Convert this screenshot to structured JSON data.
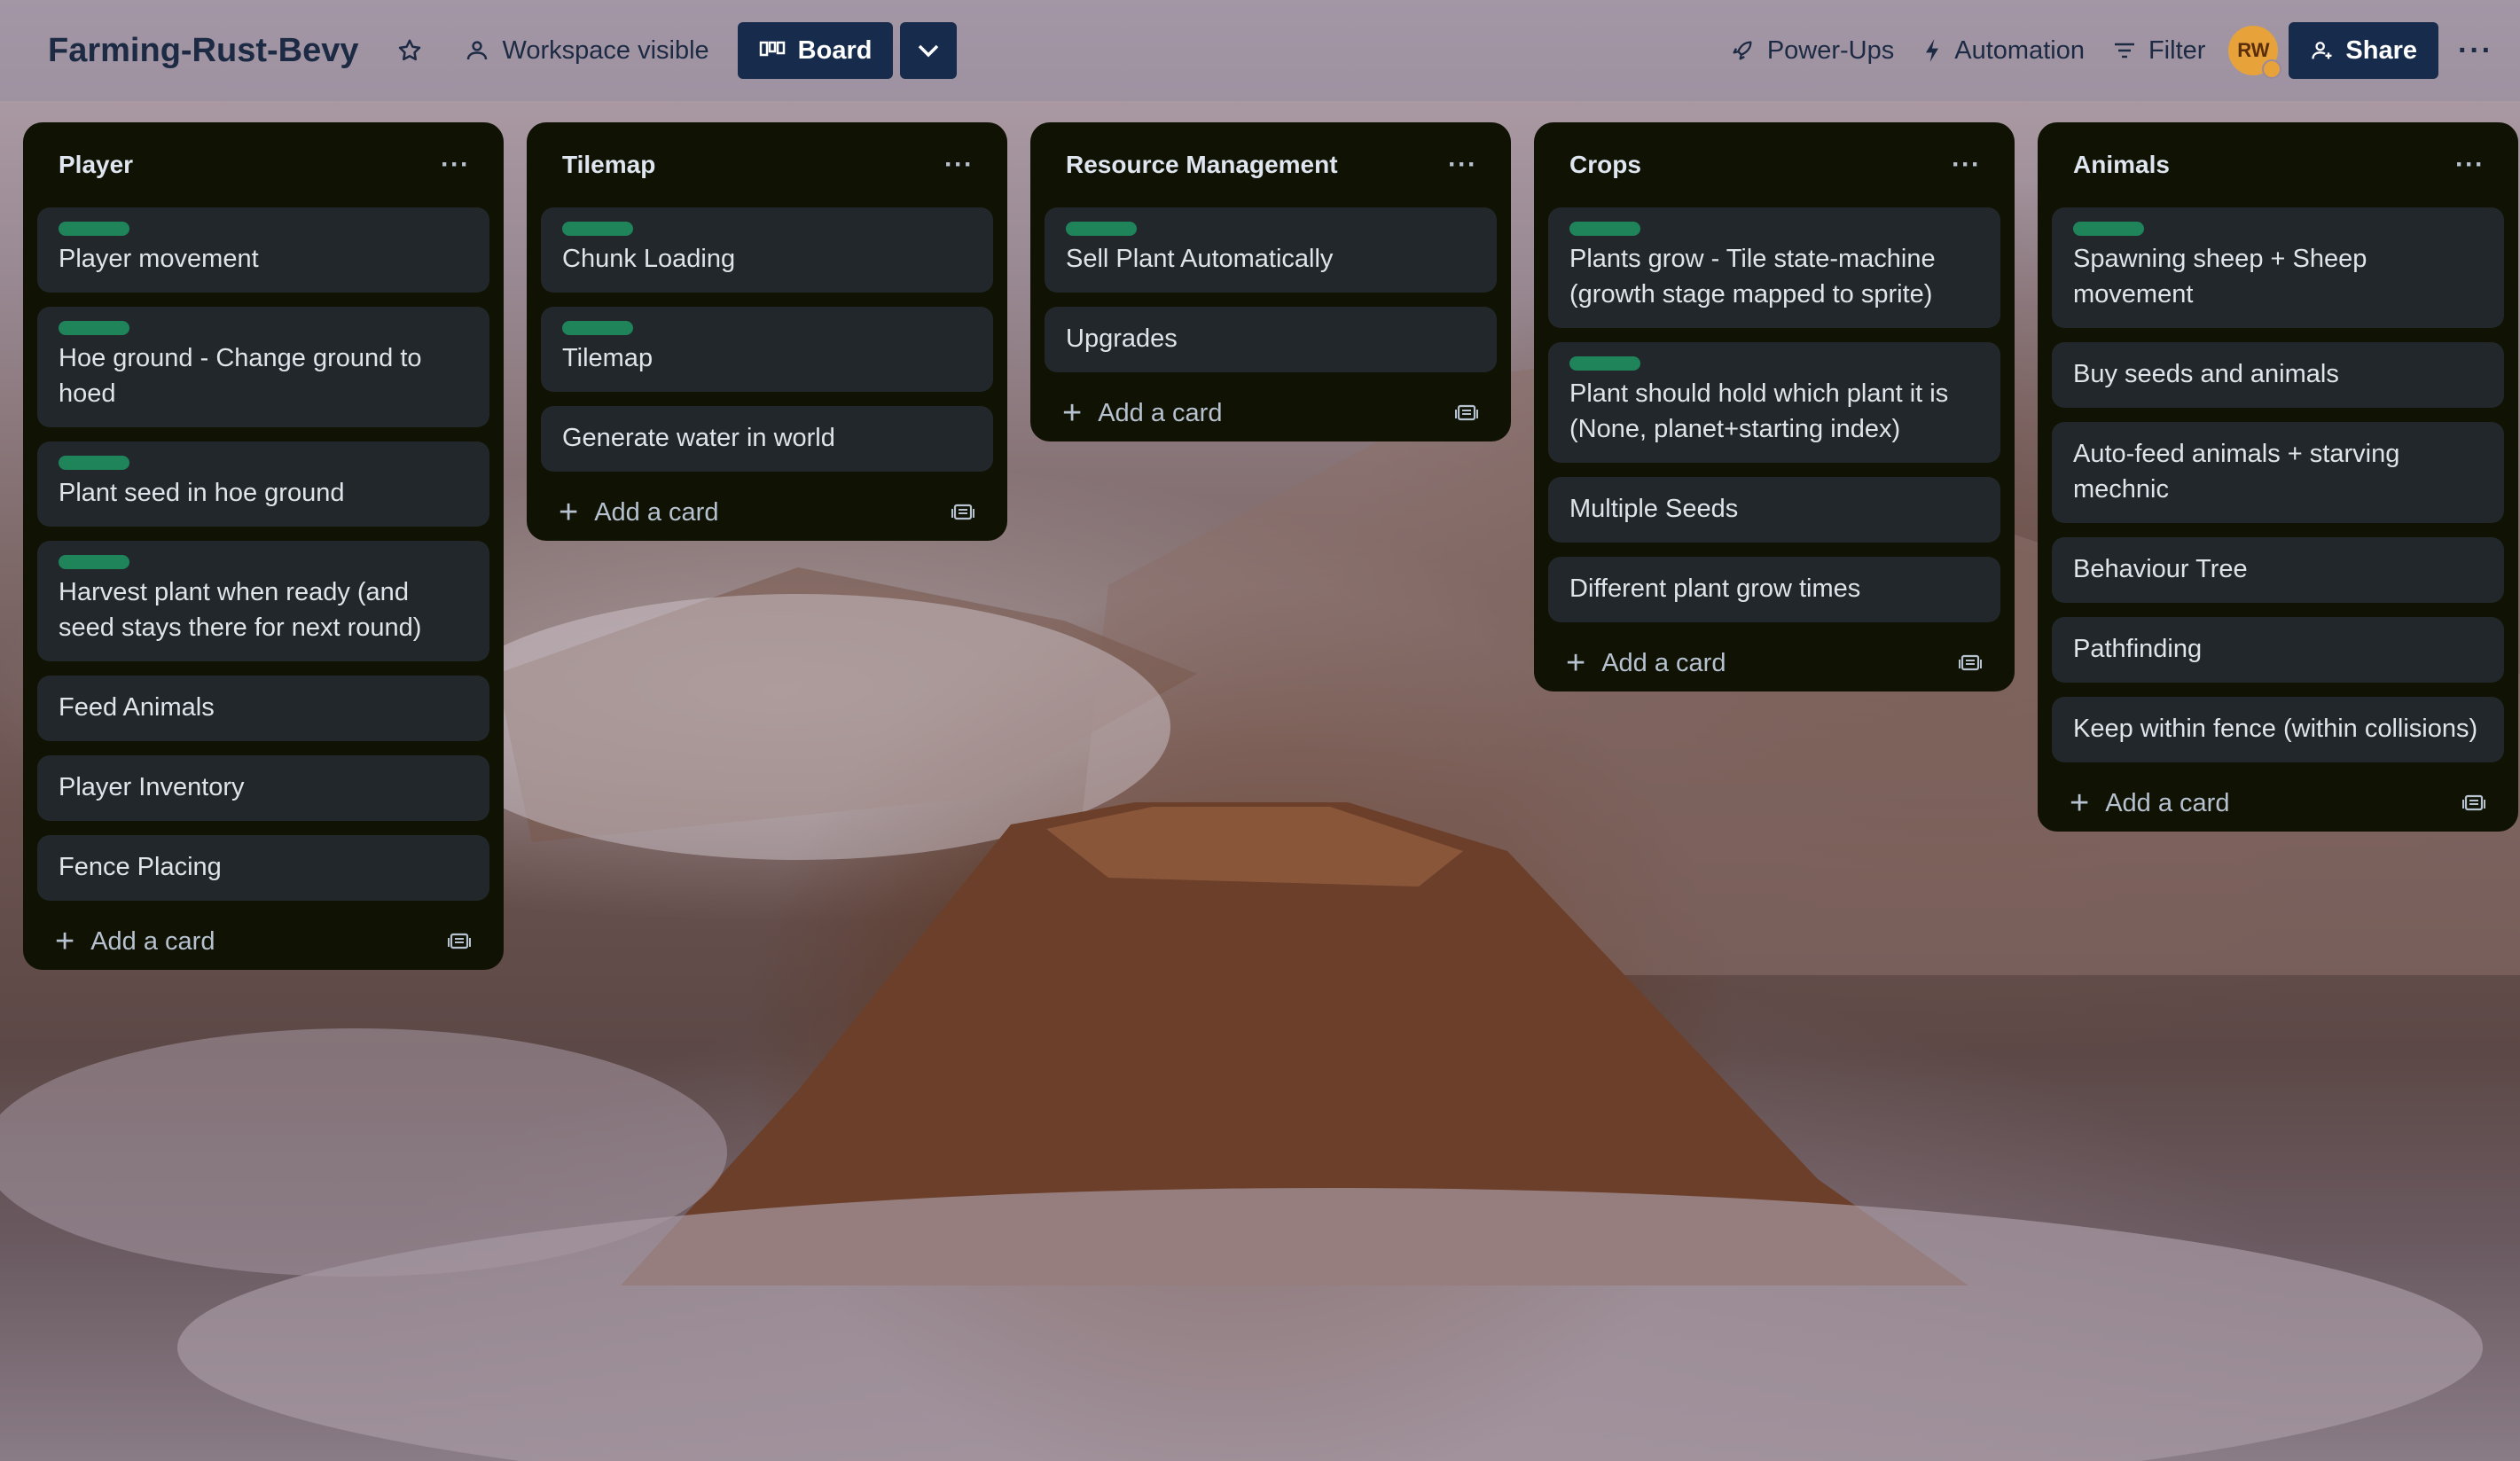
{
  "header": {
    "board_title": "Farming-Rust-Bevy",
    "visibility_label": "Workspace visible",
    "board_view_label": "Board",
    "powerups_label": "Power-Ups",
    "automation_label": "Automation",
    "filter_label": "Filter",
    "avatar_initials": "RW",
    "share_label": "Share"
  },
  "lists": [
    {
      "title": "Player",
      "add_card_label": "Add a card",
      "cards": [
        {
          "text": "Player movement",
          "label": true
        },
        {
          "text": "Hoe ground - Change ground to hoed",
          "label": true
        },
        {
          "text": "Plant seed in hoe ground",
          "label": true
        },
        {
          "text": "Harvest plant when ready (and seed stays there for next round)",
          "label": true
        },
        {
          "text": "Feed Animals",
          "label": false
        },
        {
          "text": "Player Inventory",
          "label": false
        },
        {
          "text": "Fence Placing",
          "label": false
        }
      ]
    },
    {
      "title": "Tilemap",
      "add_card_label": "Add a card",
      "cards": [
        {
          "text": "Chunk Loading",
          "label": true
        },
        {
          "text": "Tilemap",
          "label": true
        },
        {
          "text": "Generate water in world",
          "label": false
        }
      ]
    },
    {
      "title": "Resource Management",
      "add_card_label": "Add a card",
      "cards": [
        {
          "text": "Sell Plant Automatically",
          "label": true
        },
        {
          "text": "Upgrades",
          "label": false
        }
      ]
    },
    {
      "title": "Crops",
      "add_card_label": "Add a card",
      "cards": [
        {
          "text": "Plants grow - Tile state-machine (growth stage mapped to sprite)",
          "label": true
        },
        {
          "text": "Plant should hold which plant it is (None, planet+starting index)",
          "label": true
        },
        {
          "text": "Multiple Seeds",
          "label": false
        },
        {
          "text": "Different plant grow times",
          "label": false
        }
      ]
    },
    {
      "title": "Animals",
      "add_card_label": "Add a card",
      "cards": [
        {
          "text": "Spawning sheep + Sheep movement",
          "label": true
        },
        {
          "text": "Buy seeds and animals",
          "label": false
        },
        {
          "text": "Auto-feed animals + starving mechnic",
          "label": false
        },
        {
          "text": "Behaviour Tree",
          "label": false
        },
        {
          "text": "Pathfinding",
          "label": false
        },
        {
          "text": "Keep within fence (within collisions)",
          "label": false
        }
      ]
    }
  ],
  "colors": {
    "label_green": "#1f845a",
    "list_bg": "#101204",
    "card_bg": "#22272b",
    "header_button": "#172b4d",
    "avatar": "#e8a23a"
  }
}
